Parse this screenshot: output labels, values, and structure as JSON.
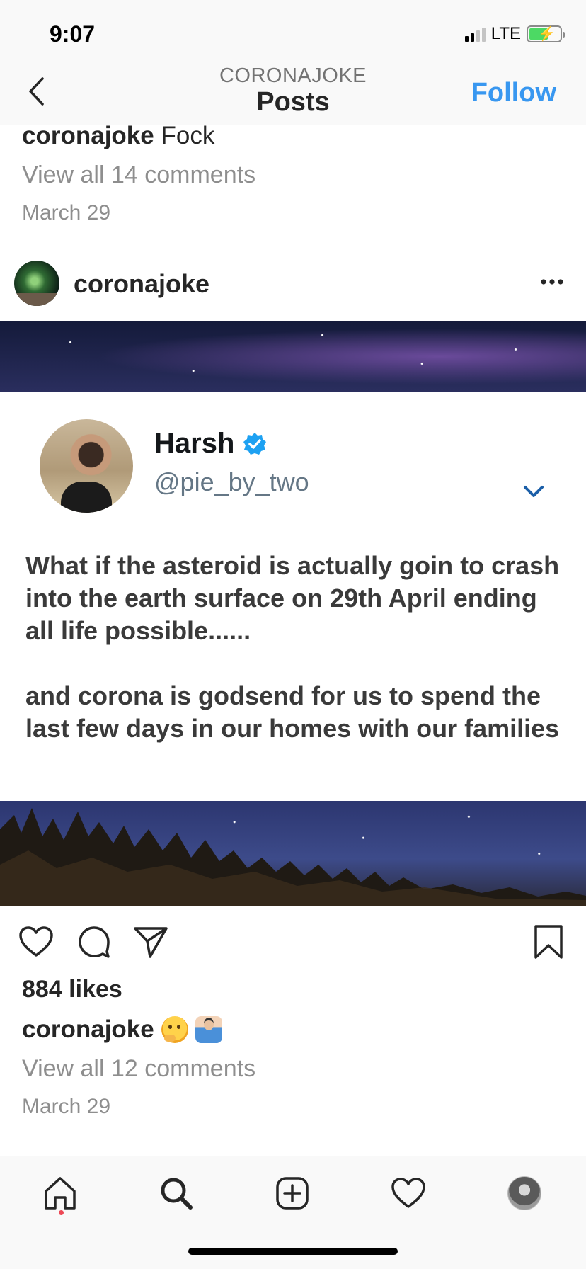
{
  "status_bar": {
    "time": "9:07",
    "network": "LTE"
  },
  "header": {
    "subtitle": "CORONAJOKE",
    "title": "Posts",
    "follow_label": "Follow"
  },
  "previous_post": {
    "caption_user": "coronajoke",
    "caption_text": "Fock",
    "comments_link": "View all 14 comments",
    "date": "March 29"
  },
  "post": {
    "username": "coronajoke",
    "tweet": {
      "name": "Harsh",
      "handle": "@pie_by_two",
      "text": "What if the asteroid is actually goin to crash into the earth surface on 29th April ending all life possible......\n\nand corona is godsend for us to spend the last few days in our homes with our families"
    },
    "likes": "884 likes",
    "caption_user": "coronajoke",
    "caption_emojis": [
      "thinking-face",
      "person-shrugging"
    ],
    "comments_link": "View all 12 comments",
    "date": "March 29"
  },
  "tab_bar": {
    "items": [
      "home-icon",
      "search-icon",
      "new-post-icon",
      "activity-heart-icon",
      "profile-avatar"
    ],
    "active": "home-icon",
    "notification_color": "#ed4956"
  },
  "colors": {
    "accent": "#3897f0",
    "verified": "#1da1f2",
    "text": "#262626",
    "muted": "#8e8e8e"
  }
}
